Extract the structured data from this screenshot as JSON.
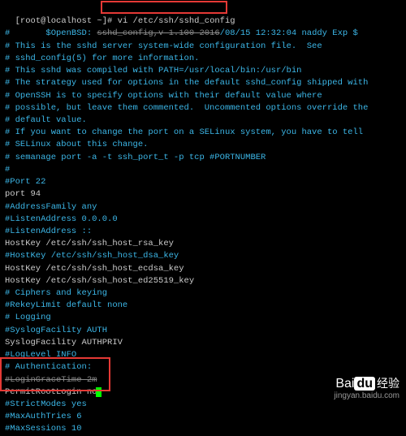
{
  "prompt": {
    "user_host": "[root@localhost ~]#",
    "command": "vi /etc/ssh/sshd_config"
  },
  "lines": [
    {
      "text": "#       $OpenBSD: sshd_config,v 1.100 2016/08/15 12:32:04 naddy Exp $",
      "cls": "comment",
      "strike_from": 18,
      "strike_to": 42
    },
    {
      "text": "",
      "cls": ""
    },
    {
      "text": "# This is the sshd server system-wide configuration file.  See",
      "cls": "comment"
    },
    {
      "text": "# sshd_config(5) for more information.",
      "cls": "comment"
    },
    {
      "text": "",
      "cls": ""
    },
    {
      "text": "# This sshd was compiled with PATH=/usr/local/bin:/usr/bin",
      "cls": "comment"
    },
    {
      "text": "",
      "cls": ""
    },
    {
      "text": "# The strategy used for options in the default sshd_config shipped with",
      "cls": "comment"
    },
    {
      "text": "# OpenSSH is to specify options with their default value where",
      "cls": "comment"
    },
    {
      "text": "# possible, but leave them commented.  Uncommented options override the",
      "cls": "comment"
    },
    {
      "text": "# default value.",
      "cls": "comment"
    },
    {
      "text": "",
      "cls": ""
    },
    {
      "text": "# If you want to change the port on a SELinux system, you have to tell",
      "cls": "comment"
    },
    {
      "text": "# SELinux about this change.",
      "cls": "comment"
    },
    {
      "text": "# semanage port -a -t ssh_port_t -p tcp #PORTNUMBER",
      "cls": "comment"
    },
    {
      "text": "#",
      "cls": "comment"
    },
    {
      "text": "#Port 22",
      "cls": "comment"
    },
    {
      "text": "port 94",
      "cls": ""
    },
    {
      "text": "#AddressFamily any",
      "cls": "comment"
    },
    {
      "text": "#ListenAddress 0.0.0.0",
      "cls": "comment"
    },
    {
      "text": "#ListenAddress ::",
      "cls": "comment"
    },
    {
      "text": "",
      "cls": ""
    },
    {
      "text": "HostKey /etc/ssh/ssh_host_rsa_key",
      "cls": ""
    },
    {
      "text": "#HostKey /etc/ssh/ssh_host_dsa_key",
      "cls": "comment"
    },
    {
      "text": "HostKey /etc/ssh/ssh_host_ecdsa_key",
      "cls": ""
    },
    {
      "text": "HostKey /etc/ssh/ssh_host_ed25519_key",
      "cls": ""
    },
    {
      "text": "",
      "cls": ""
    },
    {
      "text": "# Ciphers and keying",
      "cls": "comment"
    },
    {
      "text": "#RekeyLimit default none",
      "cls": "comment"
    },
    {
      "text": "",
      "cls": ""
    },
    {
      "text": "# Logging",
      "cls": "comment"
    },
    {
      "text": "#SyslogFacility AUTH",
      "cls": "comment"
    },
    {
      "text": "SyslogFacility AUTHPRIV",
      "cls": ""
    },
    {
      "text": "#LogLevel INFO",
      "cls": "comment"
    },
    {
      "text": "",
      "cls": ""
    },
    {
      "text": "# Authentication:",
      "cls": "comment"
    },
    {
      "text": "",
      "cls": ""
    },
    {
      "text": "#LoginGraceTime 2m",
      "cls": "comment",
      "strike_all": true
    },
    {
      "text": "PermitRootLogin no",
      "cls": "",
      "cursor": true
    },
    {
      "text": "#StrictModes yes",
      "cls": "comment"
    },
    {
      "text": "#MaxAuthTries 6",
      "cls": "comment"
    },
    {
      "text": "#MaxSessions 10",
      "cls": "comment"
    }
  ],
  "watermark": {
    "brand_left": "Bai",
    "brand_du": "du",
    "brand_right": "经验",
    "url": "jingyan.baidu.com"
  }
}
